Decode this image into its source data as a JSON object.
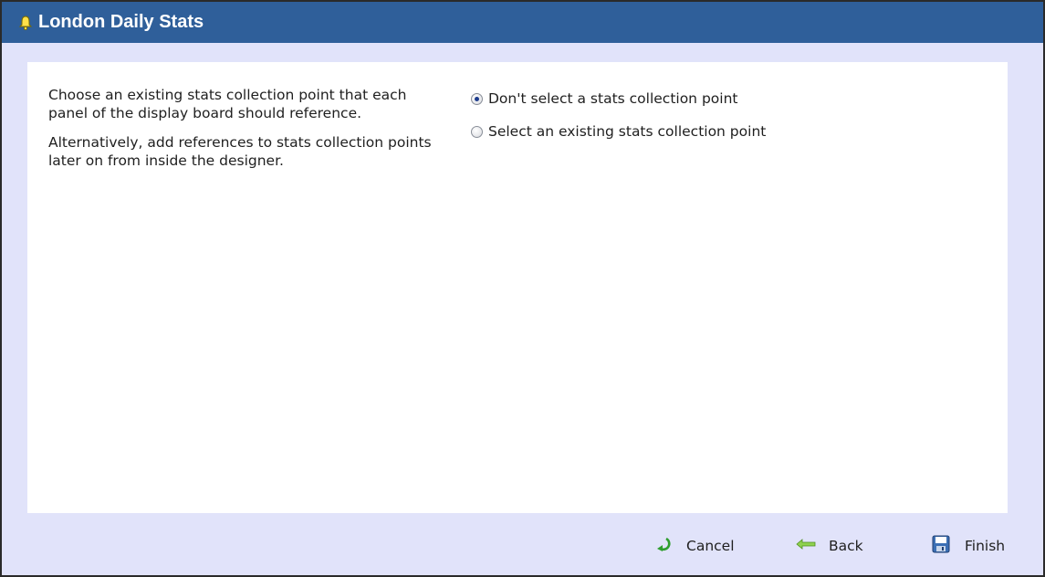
{
  "window": {
    "title": "London Daily Stats",
    "title_icon": "bell-icon"
  },
  "description": {
    "paragraph1": "Choose an existing stats collection point that each panel of the display board should reference.",
    "paragraph2": "Alternatively, add references to stats collection points later on from inside the designer."
  },
  "options": [
    {
      "label": "Don't select a stats collection point",
      "selected": true
    },
    {
      "label": "Select an existing stats collection point",
      "selected": false
    }
  ],
  "footer": {
    "cancel_label": "Cancel",
    "back_label": "Back",
    "finish_label": "Finish"
  },
  "colors": {
    "titlebar": "#2f5f9a",
    "window_bg": "#e1e3fa",
    "content_bg": "#ffffff"
  }
}
